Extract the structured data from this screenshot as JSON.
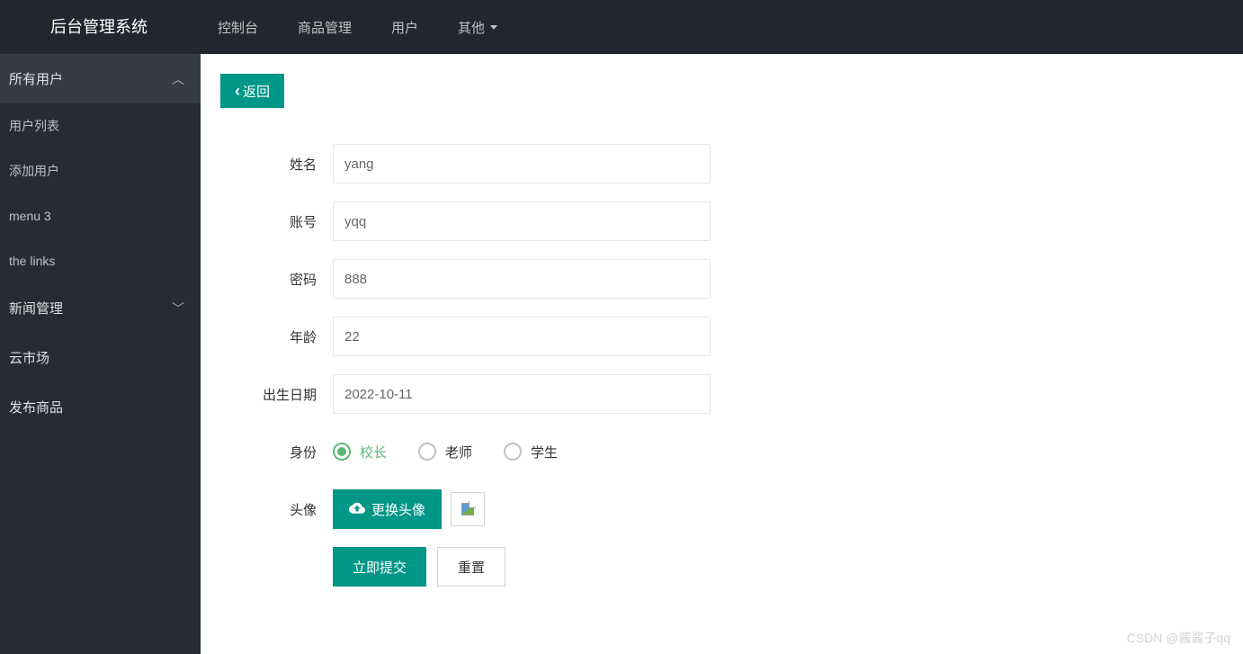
{
  "header": {
    "logo": "后台管理系统",
    "nav": [
      {
        "label": "控制台"
      },
      {
        "label": "商品管理"
      },
      {
        "label": "用户"
      },
      {
        "label": "其他",
        "hasDropdown": true
      }
    ]
  },
  "sidebar": {
    "groups": [
      {
        "label": "所有用户",
        "expanded": true,
        "items": [
          {
            "label": "用户列表"
          },
          {
            "label": "添加用户"
          },
          {
            "label": "menu 3"
          },
          {
            "label": "the links"
          }
        ]
      },
      {
        "label": "新闻管理",
        "expanded": false,
        "items": []
      }
    ],
    "items": [
      {
        "label": "云市场"
      },
      {
        "label": "发布商品"
      }
    ]
  },
  "main": {
    "back_label": "返回",
    "form": {
      "name_label": "姓名",
      "name_value": "yang",
      "account_label": "账号",
      "account_value": "yqq",
      "password_label": "密码",
      "password_value": "888",
      "age_label": "年龄",
      "age_value": "22",
      "birthday_label": "出生日期",
      "birthday_value": "2022-10-11",
      "role_label": "身份",
      "roles": [
        {
          "label": "校长",
          "checked": true
        },
        {
          "label": "老师",
          "checked": false
        },
        {
          "label": "学生",
          "checked": false
        }
      ],
      "avatar_label": "头像",
      "avatar_button": "更换头像",
      "submit_label": "立即提交",
      "reset_label": "重置"
    }
  },
  "watermark": "CSDN @酱酱子qq"
}
